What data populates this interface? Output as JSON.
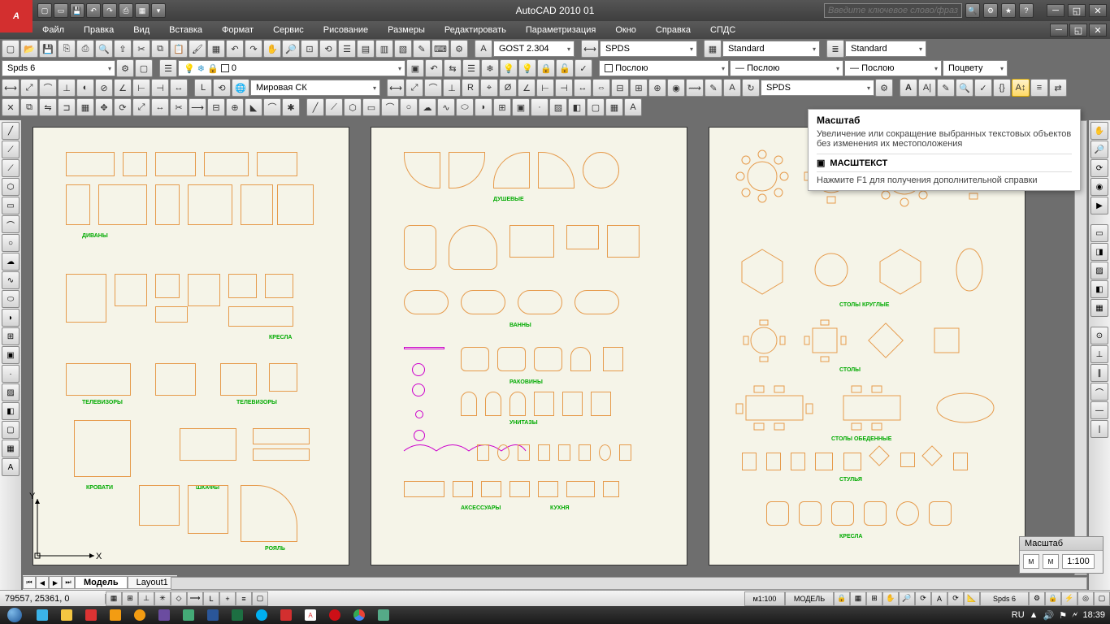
{
  "app": {
    "title": "AutoCAD 2010   01",
    "logo_letter": "A",
    "search_placeholder": "Введите ключевое слово/фразу"
  },
  "menubar": [
    "Файл",
    "Правка",
    "Вид",
    "Вставка",
    "Формат",
    "Сервис",
    "Рисование",
    "Размеры",
    "Редактировать",
    "Параметризация",
    "Окно",
    "Справка",
    "СПДС"
  ],
  "toolbar2": {
    "text_style": "GOST 2.304",
    "dim_style": "SPDS",
    "tbl_style": "Standard",
    "ml_style": "Standard",
    "spds": "Spds 6",
    "layer_val": "0",
    "coord_sys": "Мировая СК",
    "bylayer1": "Послою",
    "bylayer2": "Послою",
    "bylayer3": "Послою",
    "bycolor": "Поцвету",
    "anno_style": "SPDS"
  },
  "layout_tabs": {
    "active": "Модель",
    "other": "Layout1"
  },
  "statusbar": {
    "coords": "79557, 25361, 0",
    "scale": "м1:100",
    "space": "МОДЕЛЬ",
    "anno": "Spds 6"
  },
  "tooltip": {
    "title": "Масштаб",
    "desc": "Увеличение или сокращение выбранных текстовых объектов без изменения их местоположения",
    "command": "МАСШТЕКСТ",
    "help": "Нажмите F1 для получения дополнительной справки"
  },
  "scale_panel": {
    "title": "Масштаб",
    "value": "1:100"
  },
  "tray": {
    "lang": "RU",
    "time": "18:39"
  },
  "drawing_labels": {
    "d1": [
      "ДИВАНЫ",
      "КРЕСЛА",
      "ТЕЛЕВИЗОРЫ",
      "КРОВАТИ",
      "ШКАФЫ",
      "РОЯЛЬ"
    ],
    "d2": [
      "ДУШЕВЫЕ",
      "ВАННЫ",
      "РАКОВИНЫ",
      "УНИТАЗЫ",
      "АКСЕССУАРЫ",
      "КУХНЯ"
    ],
    "d3": [
      "СТОЛЫ КРУГЛЫЕ",
      "СТОЛЫ",
      "СТОЛЫ ОБЕДЕННЫЕ",
      "СТУЛЬЯ",
      "КРЕСЛА"
    ]
  }
}
